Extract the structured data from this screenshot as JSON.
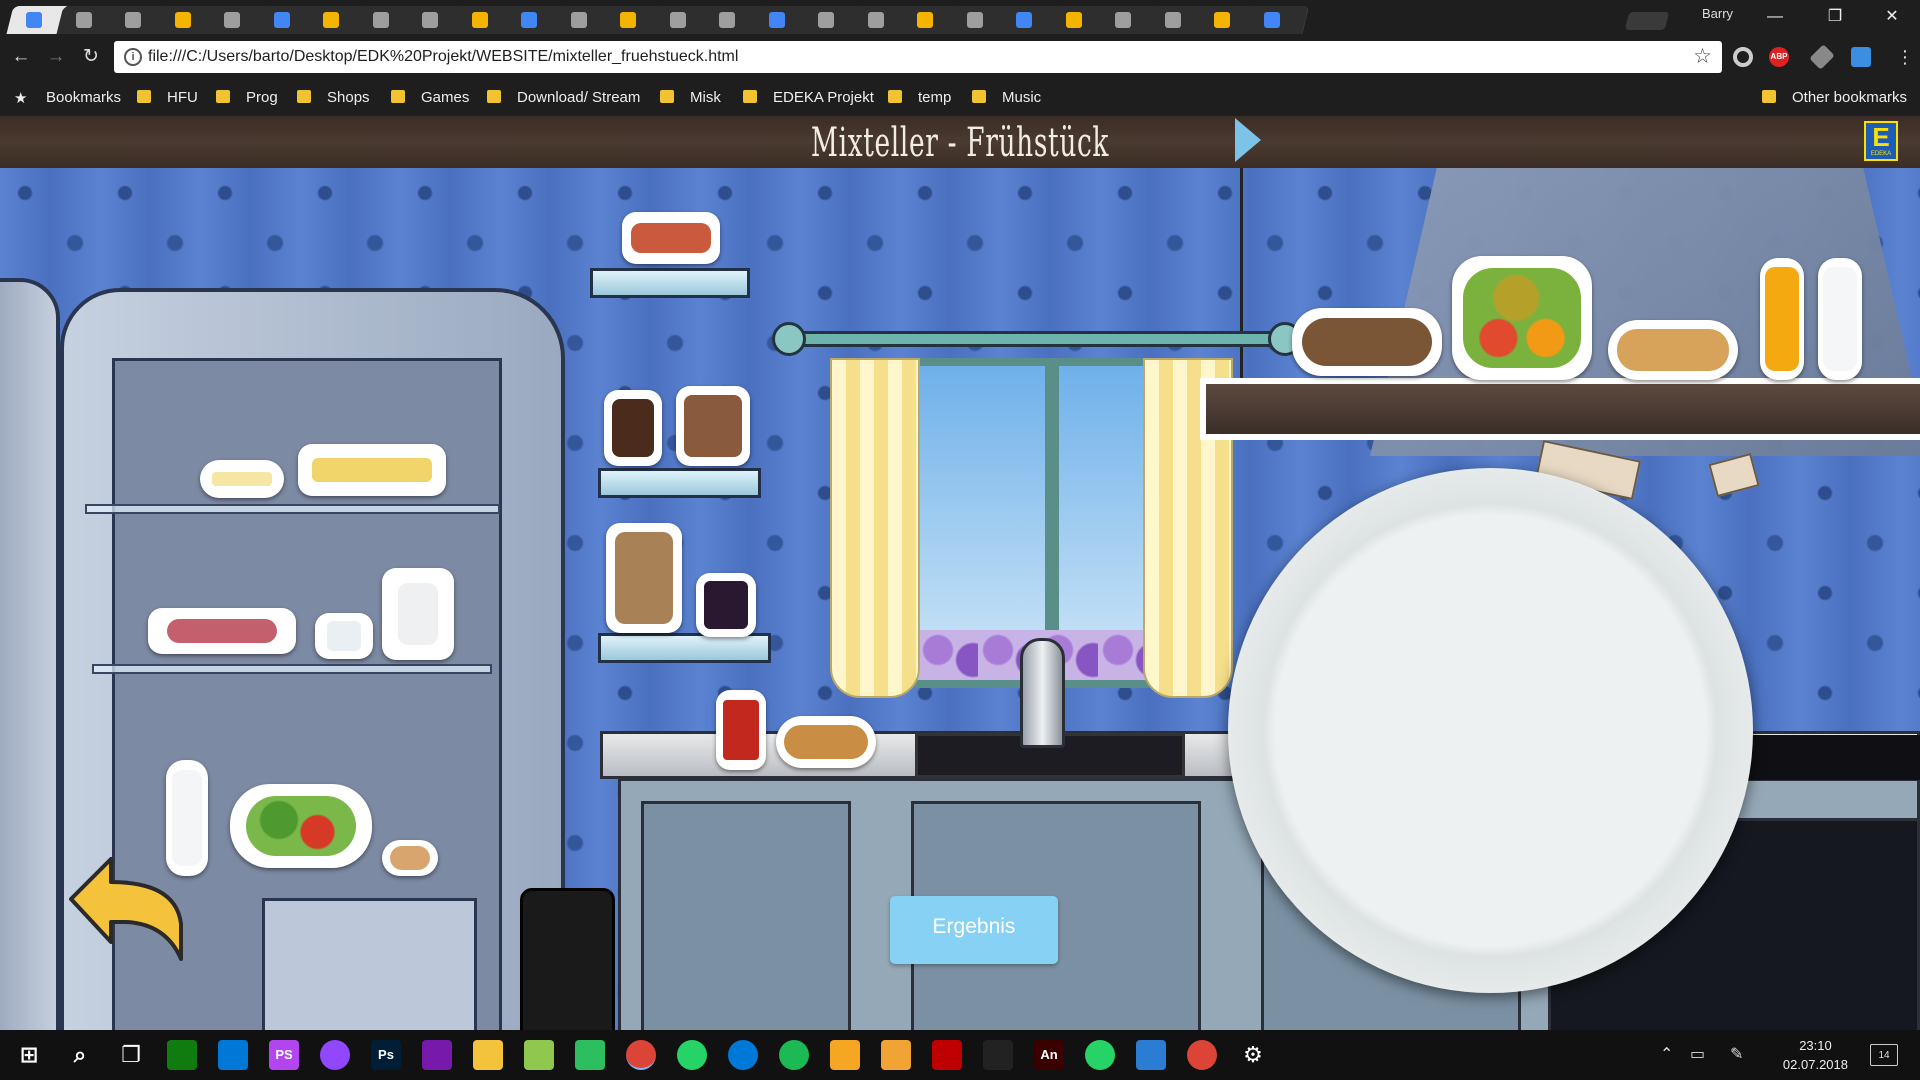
{
  "browser": {
    "tab_count": 26,
    "profile_name": "Barry",
    "window_controls": {
      "minimize": "—",
      "maximize": "❐",
      "close": "✕"
    },
    "url": "file:///C:/Users/barto/Desktop/EDK%20Projekt/WEBSITE/mixteller_fruehstueck.html",
    "nav_icons": {
      "back": "←",
      "forward": "→",
      "reload": "↻",
      "info": "i",
      "star": "☆"
    },
    "extensions": [
      "circle-extension-icon",
      "adblock-plus-icon",
      "pen-extension-icon",
      "download-extension-icon",
      "menu-icon"
    ],
    "adblock_label": "ABP"
  },
  "bookmarks": {
    "star_glyph": "★",
    "items": [
      "Bookmarks",
      "HFU",
      "Prog",
      "Shops",
      "Games",
      "Download/ Stream",
      "Misk",
      "EDEKA Projekt",
      "temp",
      "Music"
    ],
    "other": "Other bookmarks"
  },
  "page": {
    "title": "Mixteller - Frühstück",
    "brand_letter": "E",
    "brand_text": "EDEKA",
    "result_button": "Ergebnis",
    "accent_color": "#87d2f4"
  },
  "food_items": [
    "butter",
    "cheese-board",
    "cold-cuts-board",
    "yogurt-cup",
    "milk-jug-strawberries",
    "milk-bottle",
    "vegetables",
    "eggs",
    "snack-bowl",
    "nut-nougat-spread-jar",
    "coffee-jar",
    "muesli-jar",
    "jam-jar",
    "tea-glass",
    "croissant",
    "bread",
    "fruit-basket",
    "pastries",
    "orange-juice-bottle",
    "milk-bottle-shelf"
  ],
  "taskbar": {
    "apps": [
      "windows-start",
      "search",
      "task-view",
      "xbox",
      "store",
      "phpstorm",
      "twitch",
      "photoshop",
      "onenote",
      "file-explorer",
      "notepad-plus",
      "evernote",
      "chrome",
      "whatsapp",
      "edge",
      "spotify",
      "video-player",
      "visual-studio-code",
      "filezilla",
      "unity",
      "animate",
      "whatsapp-2",
      "downloads",
      "chrome-2",
      "settings"
    ],
    "time": "23:10",
    "date": "02.07.2018",
    "notification_count": "14",
    "ps_label": "PS",
    "ps2_label": "Ps",
    "an_label": "An"
  }
}
